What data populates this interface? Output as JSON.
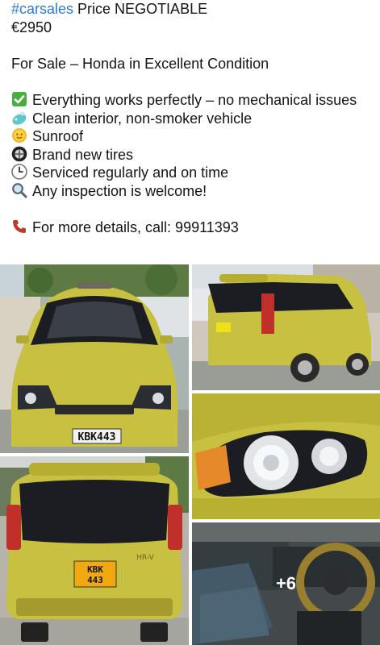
{
  "post": {
    "hashtag": "#carsales",
    "headline_rest": " Price NEGOTIABLE",
    "price": "€2950",
    "title": "For Sale – Honda in Excellent Condition",
    "features": [
      {
        "icon": "check-icon",
        "text": "Everything works perfectly – no mechanical issues"
      },
      {
        "icon": "soap-icon",
        "text": "Clean interior, non-smoker vehicle"
      },
      {
        "icon": "sun-icon",
        "text": "Sunroof"
      },
      {
        "icon": "tire-icon",
        "text": "Brand new tires"
      },
      {
        "icon": "clock-icon",
        "text": "Serviced regularly and on time"
      },
      {
        "icon": "magnifier-icon",
        "text": "Any inspection is welcome!"
      }
    ],
    "contact": {
      "icon": "phone-icon",
      "text": "For more details, call: 99911393"
    }
  },
  "gallery": {
    "plate_front": "KBK443",
    "plate_rear_line1": "KBK",
    "plate_rear_line2": "443",
    "model_badge": "HR-V",
    "more_count": "+6",
    "colors": {
      "car_body": "#c7c040",
      "car_body_dark": "#9e9728",
      "glass": "#1b1d22"
    }
  }
}
